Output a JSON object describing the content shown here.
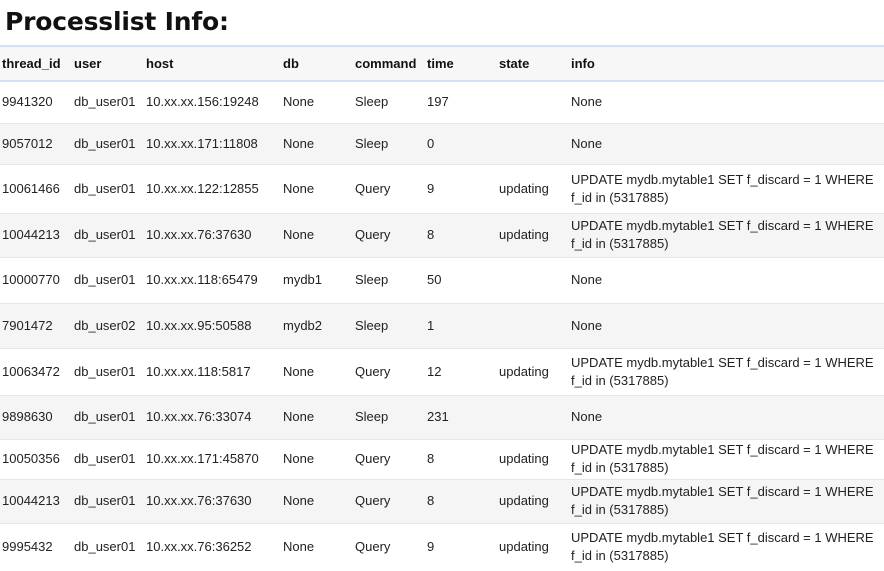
{
  "title": "Processlist Info:",
  "columns": [
    "thread_id",
    "user",
    "host",
    "db",
    "command",
    "time",
    "state",
    "info"
  ],
  "rows": [
    {
      "thread_id": "9941320",
      "user": "db_user01",
      "host": "10.xx.xx.156:19248",
      "db": "None",
      "command": "Sleep",
      "time": "197",
      "state": "",
      "info": "None"
    },
    {
      "thread_id": "9057012",
      "user": "db_user01",
      "host": "10.xx.xx.171:11808",
      "db": "None",
      "command": "Sleep",
      "time": "0",
      "state": "",
      "info": "None"
    },
    {
      "thread_id": "10061466",
      "user": "db_user01",
      "host": "10.xx.xx.122:12855",
      "db": "None",
      "command": "Query",
      "time": "9",
      "state": "updating",
      "info": "UPDATE mydb.mytable1 SET f_discard = 1 WHERE f_id in (5317885)"
    },
    {
      "thread_id": "10044213",
      "user": "db_user01",
      "host": "10.xx.xx.76:37630",
      "db": "None",
      "command": "Query",
      "time": "8",
      "state": "updating",
      "info": "UPDATE mydb.mytable1 SET f_discard = 1 WHERE f_id in (5317885)"
    },
    {
      "thread_id": "10000770",
      "user": "db_user01",
      "host": "10.xx.xx.118:65479",
      "db": "mydb1",
      "command": "Sleep",
      "time": "50",
      "state": "",
      "info": "None"
    },
    {
      "thread_id": "7901472",
      "user": "db_user02",
      "host": "10.xx.xx.95:50588",
      "db": "mydb2",
      "command": "Sleep",
      "time": "1",
      "state": "",
      "info": "None"
    },
    {
      "thread_id": "10063472",
      "user": "db_user01",
      "host": "10.xx.xx.118:5817",
      "db": "None",
      "command": "Query",
      "time": "12",
      "state": "updating",
      "info": "UPDATE mydb.mytable1 SET f_discard = 1 WHERE f_id in (5317885)"
    },
    {
      "thread_id": "9898630",
      "user": "db_user01",
      "host": "10.xx.xx.76:33074",
      "db": "None",
      "command": "Sleep",
      "time": "231",
      "state": "",
      "info": "None"
    },
    {
      "thread_id": "10050356",
      "user": "db_user01",
      "host": "10.xx.xx.171:45870",
      "db": "None",
      "command": "Query",
      "time": "8",
      "state": "updating",
      "info": "UPDATE mydb.mytable1 SET f_discard = 1 WHERE f_id in (5317885)"
    },
    {
      "thread_id": "10044213",
      "user": "db_user01",
      "host": "10.xx.xx.76:37630",
      "db": "None",
      "command": "Query",
      "time": "8",
      "state": "updating",
      "info": "UPDATE mydb.mytable1 SET f_discard = 1 WHERE f_id in (5317885)"
    },
    {
      "thread_id": "9995432",
      "user": "db_user01",
      "host": "10.xx.xx.76:36252",
      "db": "None",
      "command": "Query",
      "time": "9",
      "state": "updating",
      "info": "UPDATE mydb.mytable1 SET f_discard = 1 WHERE f_id in (5317885)"
    }
  ]
}
